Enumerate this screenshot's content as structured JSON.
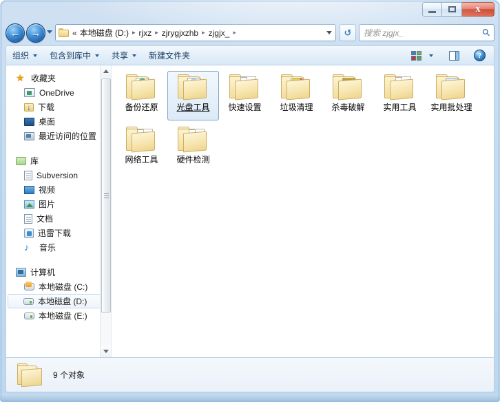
{
  "window": {
    "caption_buttons": [
      {
        "name": "minimize",
        "glyph": "minimize-icon"
      },
      {
        "name": "maximize",
        "glyph": "maximize-icon"
      },
      {
        "name": "close",
        "glyph": "close-icon",
        "label": "x"
      }
    ]
  },
  "navigation": {
    "back_label": "←",
    "forward_label": "→",
    "history_label": "recent-pages-dropdown"
  },
  "address_bar": {
    "overflow_label": "«",
    "crumbs": [
      {
        "label": "本地磁盘 (D:)"
      },
      {
        "label": "rjxz"
      },
      {
        "label": "zjrygjxzhb"
      },
      {
        "label": "zjgjx_"
      }
    ],
    "separator": "▸",
    "refresh_label": "↺"
  },
  "search": {
    "placeholder": "搜索 zjgjx_",
    "icon": "search-icon"
  },
  "toolbar": {
    "items": [
      {
        "label": "组织",
        "caret": true
      },
      {
        "label": "包含到库中",
        "caret": true
      },
      {
        "label": "共享",
        "caret": true
      },
      {
        "label": "新建文件夹",
        "caret": false
      }
    ],
    "views_icon": "views-icon",
    "views_caret": "chevron-down-icon",
    "preview_pane_icon": "preview-pane-icon",
    "help_icon": "help-icon",
    "help_label": "?"
  },
  "sidebar": {
    "groups": [
      {
        "head": {
          "label": "收藏夹",
          "icon": "star-icon"
        },
        "items": [
          {
            "label": "OneDrive",
            "icon": "onedrive-icon",
            "selected": false
          },
          {
            "label": "下载",
            "icon": "downloads-icon",
            "selected": false
          },
          {
            "label": "桌面",
            "icon": "desktop-icon",
            "selected": false
          },
          {
            "label": "最近访问的位置",
            "icon": "recent-places-icon",
            "selected": false
          }
        ]
      },
      {
        "head": {
          "label": "库",
          "icon": "library-icon"
        },
        "items": [
          {
            "label": "Subversion",
            "icon": "document-icon",
            "selected": false
          },
          {
            "label": "视频",
            "icon": "video-icon",
            "selected": false
          },
          {
            "label": "图片",
            "icon": "picture-icon",
            "selected": false
          },
          {
            "label": "文档",
            "icon": "document-icon",
            "selected": false
          },
          {
            "label": "迅雷下载",
            "icon": "xunlei-icon",
            "selected": false
          },
          {
            "label": "音乐",
            "icon": "music-icon",
            "selected": false
          }
        ]
      },
      {
        "head": {
          "label": "计算机",
          "icon": "computer-icon"
        },
        "items": [
          {
            "label": "本地磁盘 (C:)",
            "icon": "system-drive-icon",
            "selected": false
          },
          {
            "label": "本地磁盘 (D:)",
            "icon": "drive-icon",
            "selected": true
          },
          {
            "label": "本地磁盘 (E:)",
            "icon": "drive-icon",
            "selected": false
          }
        ]
      }
    ],
    "scrollbar": {
      "up_label": "scroll-up-arrow",
      "down_label": "scroll-down-arrow"
    }
  },
  "content": {
    "items": [
      {
        "label": "备份还原",
        "thumb": "th-globe",
        "style": "sheet",
        "selected": false
      },
      {
        "label": "光盘工具",
        "thumb": "th-disc",
        "style": "sheet",
        "selected": true
      },
      {
        "label": "快速设置",
        "thumb": "th-blank",
        "style": "pages",
        "selected": false
      },
      {
        "label": "垃圾清理",
        "thumb": "th-trash",
        "style": "sheet",
        "selected": false
      },
      {
        "label": "杀毒破解",
        "thumb": "th-shield",
        "style": "sheet",
        "selected": false
      },
      {
        "label": "实用工具",
        "thumb": "th-tools",
        "style": "pages",
        "selected": false
      },
      {
        "label": "实用批处理",
        "thumb": "th-batch",
        "style": "sheet",
        "selected": false
      },
      {
        "label": "网络工具",
        "thumb": "th-net",
        "style": "pages",
        "selected": false
      },
      {
        "label": "硬件检测",
        "thumb": "th-hw",
        "style": "pages",
        "selected": false
      }
    ]
  },
  "statusbar": {
    "text": "9 个对象",
    "folder_icon": "folder-icon"
  }
}
